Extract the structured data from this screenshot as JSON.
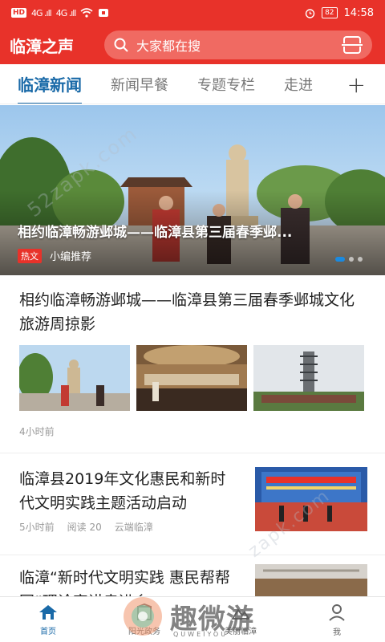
{
  "statusbar": {
    "left_chip": "HD",
    "signal1": "4G .ıll",
    "signal2": "4G .ıll",
    "battery": "82",
    "time": "14:58"
  },
  "header": {
    "brand": "临漳之声",
    "search_placeholder": "大家都在搜",
    "search_icon": "search-icon",
    "scan_icon": "scan-icon"
  },
  "tabs": [
    {
      "label": "临漳新闻",
      "active": true
    },
    {
      "label": "新闻早餐"
    },
    {
      "label": "专题专栏"
    },
    {
      "label": "走进"
    }
  ],
  "tabs_add": "+",
  "banner": {
    "title": "相约临漳畅游邺城——临漳县第三届春季邺...",
    "tag": "热文",
    "source": "小编推荐"
  },
  "articles": [
    {
      "title": "相约临漳畅游邺城——临漳县第三届春季邺城文化旅游周掠影",
      "time": "4小时前"
    },
    {
      "title": "临漳县2019年文化惠民和新时代文明实践主题活动启动",
      "time": "5小时前",
      "reads": "阅读 20",
      "source": "云端临漳"
    },
    {
      "title": "临漳“新时代文明实践 惠民帮帮团”理论宣讲走进乡"
    }
  ],
  "bottom_nav": [
    {
      "label": "首页",
      "icon": "home-icon",
      "active": true
    },
    {
      "label": "阳光政务",
      "icon": "government-icon"
    },
    {
      "label": "美丽临漳",
      "icon": "landscape-icon"
    },
    {
      "label": "我",
      "icon": "user-icon"
    }
  ],
  "watermark": {
    "text": "趣微游",
    "sub": "QUWEIYOU",
    "diag": "52zapk.com",
    "diag2": "zapk.com"
  },
  "colors": {
    "brand_red": "#e8322a",
    "active_blue": "#1a6aa8"
  }
}
